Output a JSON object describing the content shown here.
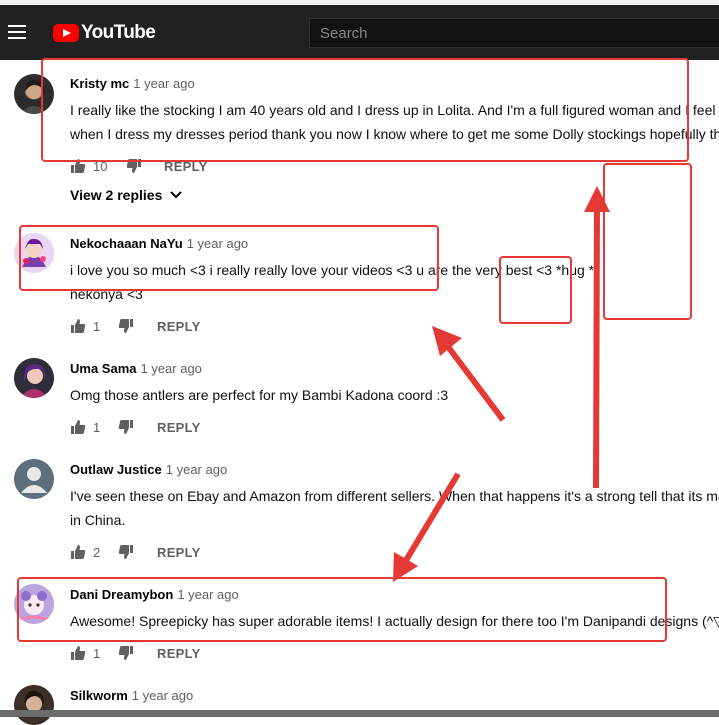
{
  "header": {
    "logo_text": "YouTube",
    "search_placeholder": "Search"
  },
  "comments": [
    {
      "author": "Kristy mc",
      "time": "1 year ago",
      "lines": [
        "I really like the stocking I am 40 years old and I dress up in Lolita. And I'm a full figured woman and I feel t",
        "when I dress my dresses period thank you now I know where to get me some Dolly stockings hopefully th"
      ],
      "likes": "10",
      "reply_label": "REPLY",
      "view_replies": "View 2 replies"
    },
    {
      "author": "Nekochaaan NaYu",
      "time": "1 year ago",
      "lines": [
        "i love you so much <3 i really really love your videos <3 u are the very best <3 *hug *",
        "nekonya <3"
      ],
      "likes": "1",
      "reply_label": "REPLY"
    },
    {
      "author": "Uma Sama",
      "time": "1 year ago",
      "lines": [
        "Omg those antlers are perfect for my Bambi Kadona coord :3"
      ],
      "likes": "1",
      "reply_label": "REPLY"
    },
    {
      "author": "Outlaw Justice",
      "time": "1 year ago",
      "lines": [
        "I've seen these on Ebay and Amazon from different sellers. When that happens it's a strong tell that its ma",
        "in China."
      ],
      "likes": "2",
      "reply_label": "REPLY"
    },
    {
      "author": "Dani Dreamybon",
      "time": "1 year ago",
      "lines": [
        "Awesome! Spreepicky has super adorable items! I actually design for there too I'm Danipandi designs  (^▽"
      ],
      "likes": "1",
      "reply_label": "REPLY"
    },
    {
      "author": "Silkworm",
      "time": "1 year ago"
    }
  ],
  "colors": {
    "header_bg": "#212121",
    "annotation_red": "#e53935",
    "brand_red": "#ff0000"
  }
}
